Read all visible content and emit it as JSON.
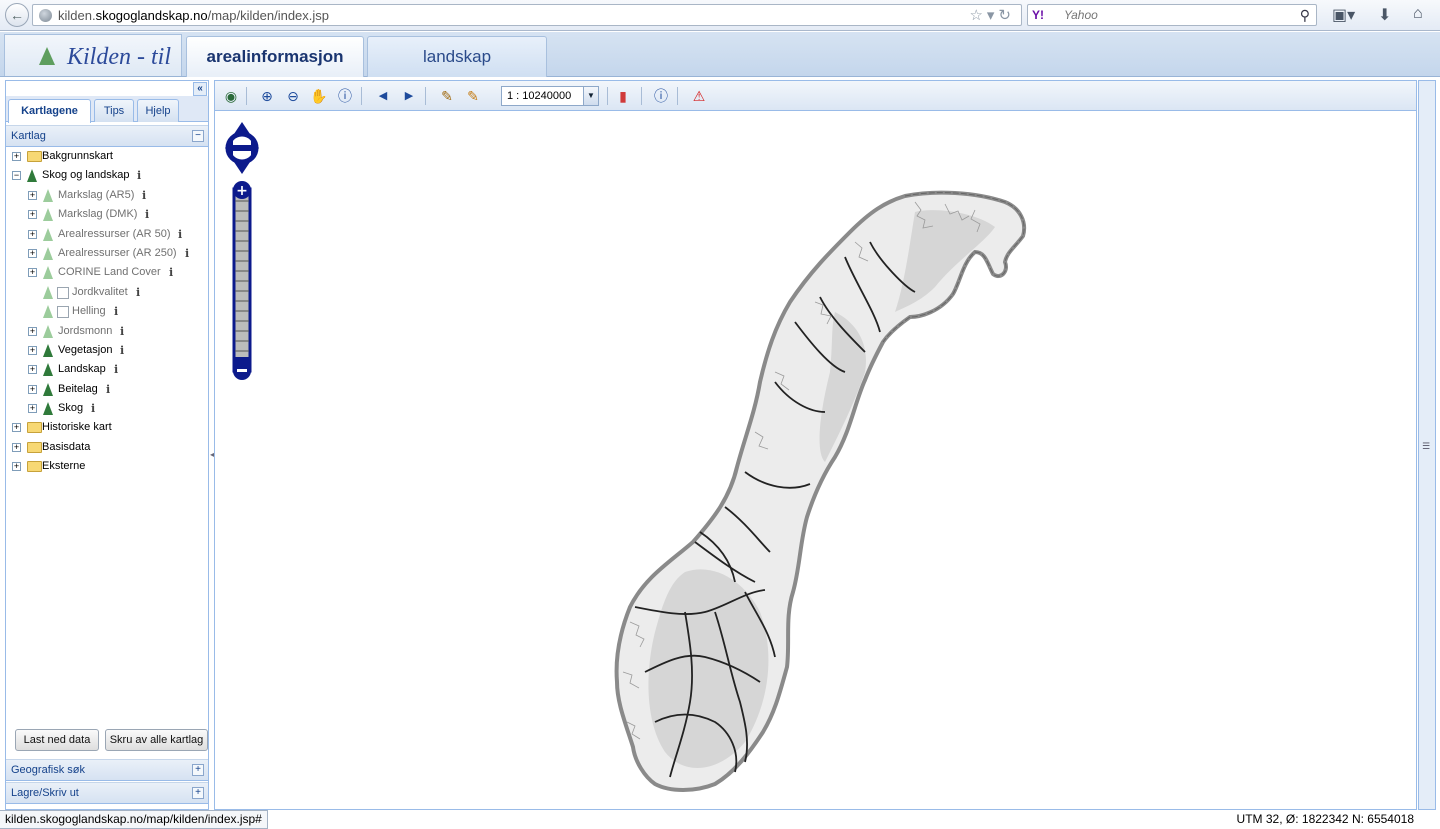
{
  "browser": {
    "url_prefix": "kilden.",
    "url_domain": "skogoglandskap.no",
    "url_path": "/map/kilden/index.jsp",
    "search_placeholder": "Yahoo",
    "search_engine_icon": "Y!"
  },
  "header": {
    "logo_text": "Kilden - til",
    "tabs": [
      {
        "label": "arealinformasjon",
        "active": true
      },
      {
        "label": "landskap",
        "active": false
      }
    ]
  },
  "left_panel": {
    "tabs": [
      "Kartlagene",
      "Tips",
      "Hjelp"
    ],
    "kartlag_title": "Kartlag",
    "tree": [
      {
        "label": "Bakgrunnskart",
        "type": "folder",
        "level": 0,
        "expanded": false
      },
      {
        "label": "Skog og landskap",
        "type": "layer",
        "level": 0,
        "expanded": true,
        "dim": false,
        "info": "i"
      },
      {
        "label": "Markslag (AR5)",
        "type": "layer",
        "level": 1,
        "dim": true,
        "info": "i"
      },
      {
        "label": "Markslag (DMK)",
        "type": "layer",
        "level": 1,
        "dim": true,
        "info": "i"
      },
      {
        "label": "Arealressurser (AR 50)",
        "type": "layer",
        "level": 1,
        "dim": true,
        "info": "i"
      },
      {
        "label": "Arealressurser (AR 250)",
        "type": "layer",
        "level": 1,
        "dim": true,
        "info": "i"
      },
      {
        "label": "CORINE Land Cover",
        "type": "layer",
        "level": 1,
        "dim": true,
        "info": "i"
      },
      {
        "label": "Jordkvalitet",
        "type": "checkbox",
        "level": 1,
        "dim": true,
        "info": "i"
      },
      {
        "label": "Helling",
        "type": "checkbox",
        "level": 1,
        "dim": true,
        "info": "i"
      },
      {
        "label": "Jordsmonn",
        "type": "layer",
        "level": 1,
        "dim": true,
        "info": "i"
      },
      {
        "label": "Vegetasjon",
        "type": "layer",
        "level": 1,
        "dim": false,
        "info": "i"
      },
      {
        "label": "Landskap",
        "type": "layer",
        "level": 1,
        "dim": false,
        "info": "i"
      },
      {
        "label": "Beitelag",
        "type": "layer",
        "level": 1,
        "dim": false,
        "info": "i"
      },
      {
        "label": "Skog",
        "type": "layer",
        "level": 1,
        "dim": false,
        "info": "i"
      },
      {
        "label": "Historiske kart",
        "type": "folder",
        "level": 0,
        "expanded": false
      },
      {
        "label": "Basisdata",
        "type": "folder",
        "level": 0,
        "expanded": false
      },
      {
        "label": "Eksterne",
        "type": "folder",
        "level": 0,
        "expanded": false
      }
    ],
    "buttons": {
      "download": "Last ned data",
      "turn_off_all": "Skru av alle kartlag"
    },
    "sections": {
      "geo_search": "Geografisk søk",
      "save_print": "Lagre/Skriv ut"
    }
  },
  "map": {
    "scale": "1 : 10240000",
    "coordinates": "UTM 32, Ø: 1822342 N: 6554018"
  },
  "status": {
    "link_url": "kilden.skogoglandskap.no/map/kilden/index.jsp#"
  },
  "colors": {
    "panel_border": "#99bbe8",
    "active_tab_text": "#1a3570",
    "nav_blue": "#0c1a8c"
  }
}
